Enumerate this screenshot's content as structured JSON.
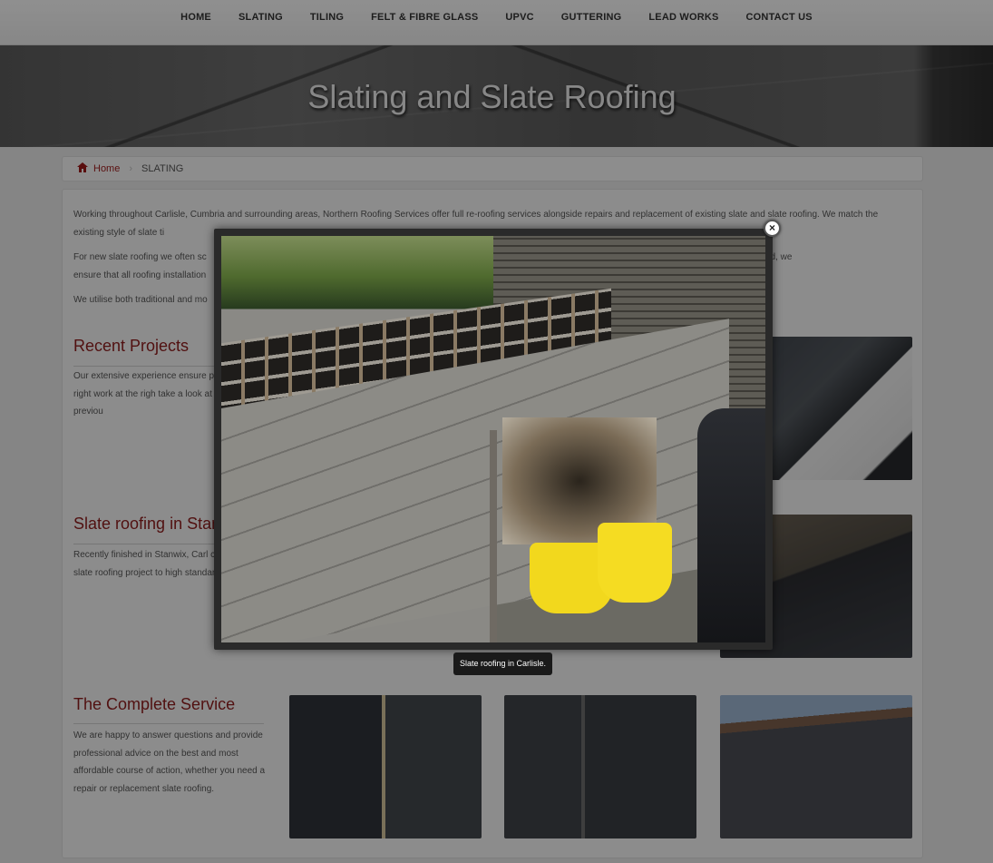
{
  "nav": {
    "items": [
      "HOME",
      "SLATING",
      "TILING",
      "FELT & FIBRE GLASS",
      "UPVC",
      "GUTTERING",
      "LEAD WORKS",
      "CONTACT US"
    ]
  },
  "banner": {
    "title": "Slating and Slate Roofing"
  },
  "breadcrumb": {
    "home": "Home",
    "current": "SLATING"
  },
  "intro": {
    "p1": "Working throughout Carlisle, Cumbria and surrounding areas, Northern Roofing Services offer full re-roofing services alongside repairs and replacement of existing slate and slate roofing. We match the existing style of slate ti",
    "p2a": "For new slate roofing we often sc",
    "p2b": "opriate. Where needed, we",
    "p2c": "ensure that all roofing installation",
    "p3": "We utilise both traditional and mo"
  },
  "sections": {
    "recent": {
      "title": "Recent Projects",
      "text": "Our extensive experience ensure provide the right work at the righ take a look at some of our previou"
    },
    "stanwix": {
      "title": "Slate roofing in Stan",
      "text": "Recently finished in Stanwix, Carl complete slate roofing project to high standards."
    },
    "complete": {
      "title": "The Complete Service",
      "text": "We are happy to answer questions and provide professional advice on the best and most affordable course of action, whether you need a repair or replacement slate roofing."
    }
  },
  "lightbox": {
    "caption": "Slate roofing in Carlisle.",
    "close_label": "×"
  },
  "icons": {
    "home": "home-icon",
    "close": "close-icon"
  },
  "colors": {
    "accent": "#8c1c1c",
    "overlay": "rgba(0,0,0,0.42)"
  }
}
